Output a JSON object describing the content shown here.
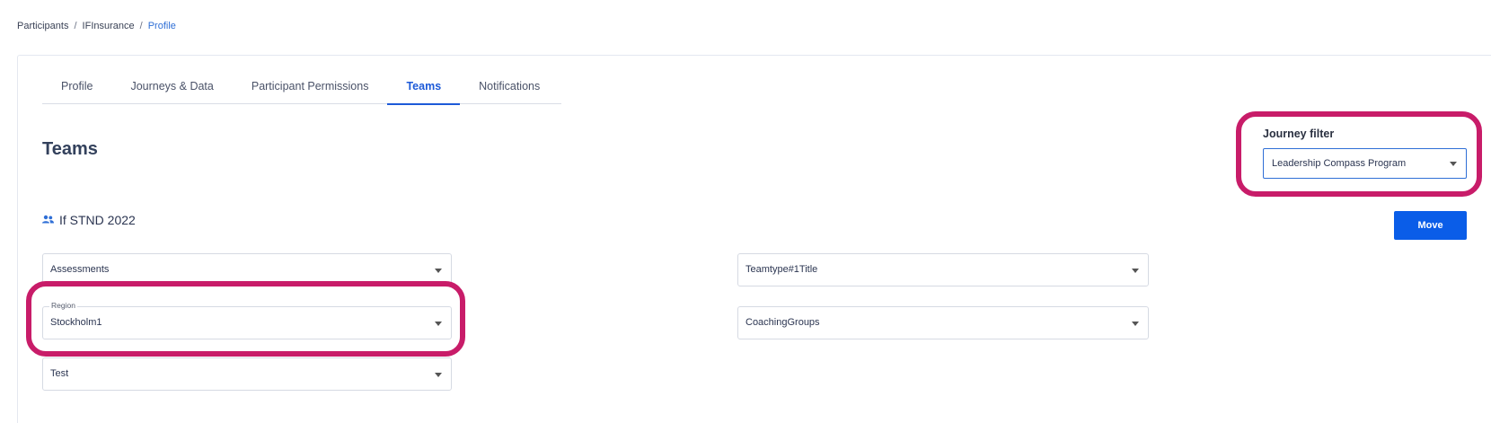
{
  "breadcrumb": {
    "items": [
      "Participants",
      "IFInsurance",
      "Profile"
    ],
    "separator": "/"
  },
  "tabs": [
    {
      "label": "Profile",
      "active": false
    },
    {
      "label": "Journeys & Data",
      "active": false
    },
    {
      "label": "Participant Permissions",
      "active": false
    },
    {
      "label": "Teams",
      "active": true
    },
    {
      "label": "Notifications",
      "active": false
    }
  ],
  "page": {
    "title": "Teams"
  },
  "journey_filter": {
    "label": "Journey filter",
    "selected": "Leadership Compass Program"
  },
  "actions": {
    "move_label": "Move"
  },
  "team": {
    "icon": "users-icon",
    "name": "If STND 2022",
    "fields": {
      "assessments": "Assessments",
      "region_label": "Region",
      "region_value": "Stockholm1",
      "test": "Test",
      "teamtype": "Teamtype#1Title",
      "coaching_groups": "CoachingGroups"
    }
  },
  "colors": {
    "accent": "#1d5ad8",
    "button": "#0a5de8",
    "highlight": "#c81c69"
  }
}
